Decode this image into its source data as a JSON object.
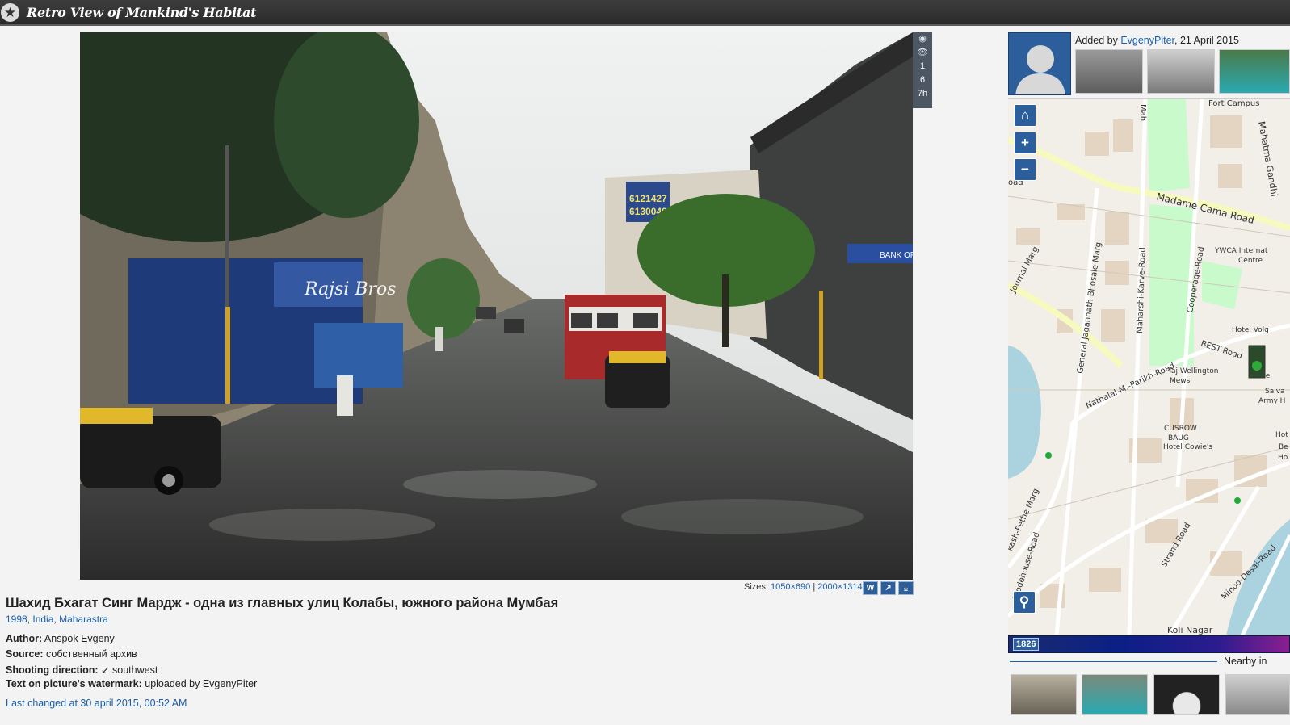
{
  "header": {
    "site_title": "Retro View of Mankind's Habitat",
    "logo_icon": "star-logo-icon"
  },
  "photo": {
    "sign_text": "Rajsi Bros",
    "bus_board_line1": "6121427",
    "bus_board_line2": "6130040",
    "bank_sign": "BANK OF IND"
  },
  "stats": {
    "views_today": "1",
    "views_total": "6",
    "age": "7h"
  },
  "sizes": {
    "label": "Sizes:",
    "size1": "1050×690",
    "separator": "|",
    "size2": "2000×1314",
    "btn_w": "W"
  },
  "caption": {
    "title": "Шахид Бхагат Синг Мардж - одна из главных улиц Колабы, южного района Мумбая",
    "year": "1998",
    "country": "India",
    "region": "Maharastra"
  },
  "info": {
    "author_label": "Author:",
    "author": "Anspok Evgeny",
    "source_label": "Source:",
    "source": "собственный архив",
    "direction_label": "Shooting direction:",
    "direction": "↙ southwest",
    "watermark_label": "Text on picture's watermark:",
    "watermark": "uploaded by EvgenyPiter",
    "last_changed": "Last changed at 30 april 2015, 00:52 AM"
  },
  "uploader": {
    "added_by_prefix": "Added by",
    "user": "EvgenyPiter",
    "date": ", 21 April 2015"
  },
  "map": {
    "labels": {
      "fort_campus": "Fort Campus",
      "madame_cama": "Madame Cama Road",
      "mahatma": "Mahatma Gandhi",
      "mah": "Mah",
      "bhosale": "General Jagannath Bhosale Marg",
      "karve": "Maharshi-Karve-Road",
      "cooperage": "Cooperage-Road",
      "ywca": "YWCA Internat",
      "centre": "Centre",
      "hotel_volga": "Hotel Volg",
      "best_road": "BEST-Road",
      "hotel_short": "Hote",
      "parikh": "Nathalal-M.-Parikh-Road",
      "taj": "Taj Wellington",
      "mews": "Mews",
      "salva": "Salva",
      "army": "Army H",
      "cusrow": "CUSROW",
      "baug": "BAUG",
      "hotel_cowie": "Hotel Cowie's",
      "hot": "Hot",
      "be": "Be",
      "ho": "Ho",
      "journal": "Journal Marg",
      "pethe": "kash-Pethe Marg",
      "wodehouse": "Wodehouse-Road",
      "strand": "Strand Road",
      "minoo": "Minoo-Desai-Road",
      "koli": "Koli Nagar",
      "oad": "oad"
    },
    "home_icon": "home-icon",
    "zoom_in": "+",
    "zoom_out": "−"
  },
  "timeline": {
    "year": "1826"
  },
  "nearby": {
    "label": "Nearby in"
  }
}
